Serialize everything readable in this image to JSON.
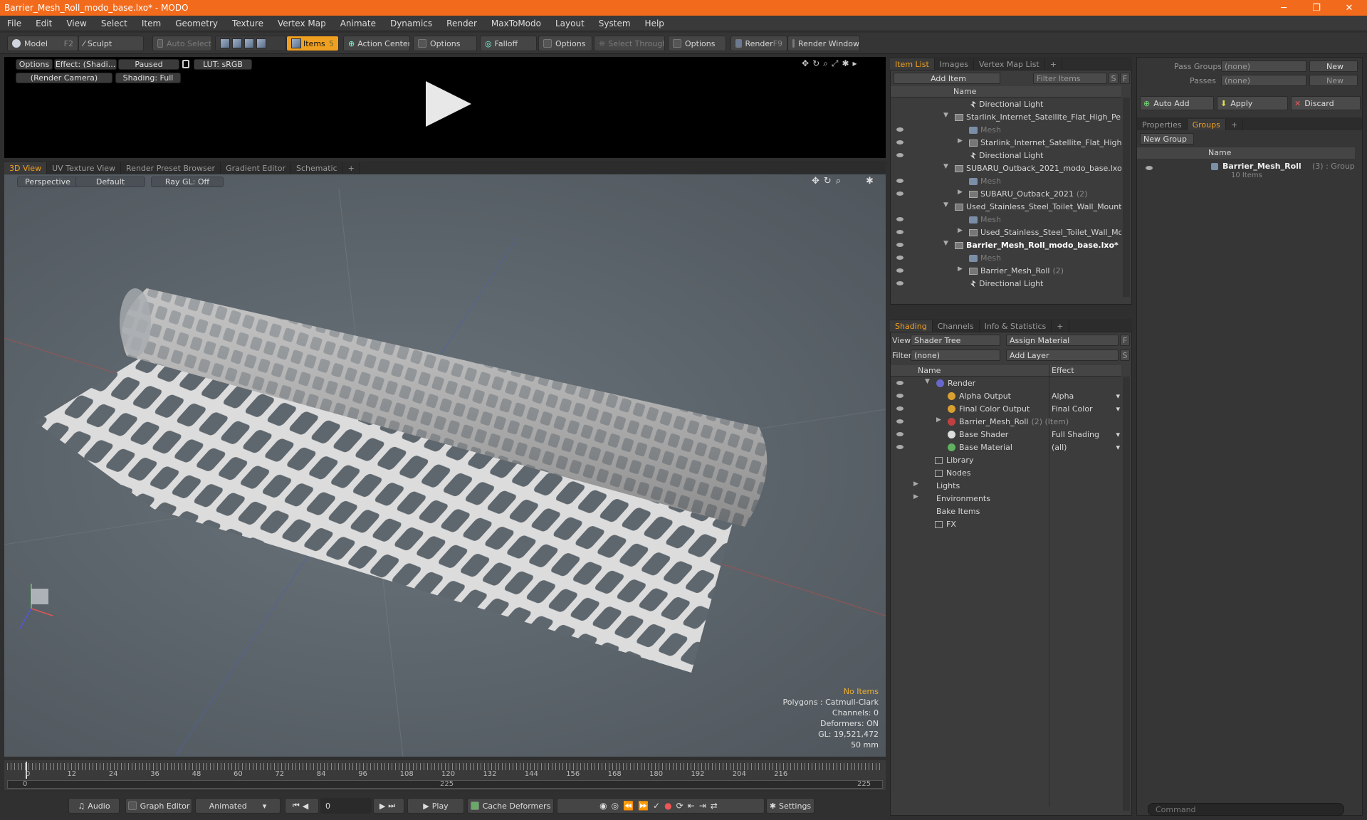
{
  "window": {
    "title": "Barrier_Mesh_Roll_modo_base.lxo* - MODO",
    "minimize": "─",
    "maximize": "❐",
    "close": "✕"
  },
  "menu": [
    "File",
    "Edit",
    "View",
    "Select",
    "Item",
    "Geometry",
    "Texture",
    "Vertex Map",
    "Animate",
    "Dynamics",
    "Render",
    "MaxToModo",
    "Layout",
    "System",
    "Help"
  ],
  "toolbar": {
    "model": "Model",
    "model_key": "F2",
    "sculpt": "Sculpt",
    "auto_select": "Auto Select",
    "items": "Items",
    "items_key": "5",
    "action_center": "Action Center",
    "options1": "Options",
    "falloff": "Falloff",
    "options2": "Options",
    "select_through": "Select Through",
    "options3": "Options",
    "render": "Render",
    "render_key": "F9",
    "render_window": "Render Window"
  },
  "render_view": {
    "options": "Options",
    "effect": "Effect: (Shadi...",
    "paused": "Paused",
    "lut": "LUT: sRGB",
    "camera": "(Render Camera)",
    "shading": "Shading: Full"
  },
  "view_tabs": [
    "3D View",
    "UV Texture View",
    "Render Preset Browser",
    "Gradient Editor",
    "Schematic",
    "+"
  ],
  "viewport": {
    "perspective": "Perspective",
    "default": "Default",
    "raygl": "Ray GL: Off"
  },
  "viewport_info": {
    "no_items": "No Items",
    "polygons": "Polygons : Catmull-Clark",
    "channels": "Channels: 0",
    "deformers": "Deformers: ON",
    "gl": "GL: 19,521,472",
    "scale": "50 mm"
  },
  "timeline": {
    "ticks": [
      "0",
      "12",
      "24",
      "36",
      "48",
      "60",
      "72",
      "84",
      "96",
      "108",
      "120",
      "132",
      "144",
      "156",
      "168",
      "180",
      "192",
      "204",
      "216"
    ],
    "start": "0",
    "mid": "225",
    "end": "225"
  },
  "bottombar": {
    "audio": "Audio",
    "graph_editor": "Graph Editor",
    "animated": "Animated",
    "frame": "0",
    "play": "Play",
    "cache_deformers": "Cache Deformers",
    "settings": "Settings"
  },
  "item_list": {
    "tabs": [
      "Item List",
      "Images",
      "Vertex Map List",
      "+"
    ],
    "add_item": "Add Item",
    "filter_items": "Filter Items",
    "s": "S",
    "f": "F",
    "col_name": "Name",
    "rows": [
      {
        "label": "Directional Light",
        "extra": ""
      },
      {
        "label": "Starlink_Internet_Satellite_Flat_High_Pe...",
        "extra": ""
      },
      {
        "label": "Mesh",
        "extra": ""
      },
      {
        "label": "Starlink_Internet_Satellite_Flat_High_...",
        "extra": ""
      },
      {
        "label": "Directional Light",
        "extra": ""
      },
      {
        "label": "SUBARU_Outback_2021_modo_base.lxo*",
        "extra": ""
      },
      {
        "label": "Mesh",
        "extra": ""
      },
      {
        "label": "SUBARU_Outback_2021",
        "extra": "(2)"
      },
      {
        "label": "Used_Stainless_Steel_Toilet_Wall_Mount...",
        "extra": ""
      },
      {
        "label": "Mesh",
        "extra": ""
      },
      {
        "label": "Used_Stainless_Steel_Toilet_Wall_Mo ...",
        "extra": ""
      },
      {
        "label": "Barrier_Mesh_Roll_modo_base.lxo*",
        "extra": ""
      },
      {
        "label": "Mesh",
        "extra": ""
      },
      {
        "label": "Barrier_Mesh_Roll",
        "extra": "(2)"
      },
      {
        "label": "Directional Light",
        "extra": ""
      }
    ]
  },
  "shading": {
    "tabs": [
      "Shading",
      "Channels",
      "Info & Statistics",
      "+"
    ],
    "view_label": "View",
    "view_value": "Shader Tree",
    "assign_material": "Assign Material",
    "f": "F",
    "filter_label": "Filter",
    "filter_value": "(none)",
    "add_layer": "Add Layer",
    "s": "S",
    "col_name": "Name",
    "col_effect": "Effect",
    "rows": [
      {
        "label": "Render",
        "effect": ""
      },
      {
        "label": "Alpha Output",
        "effect": "Alpha"
      },
      {
        "label": "Final Color Output",
        "effect": "Final Color"
      },
      {
        "label": "Barrier_Mesh_Roll",
        "extra": "(2) (Item)",
        "effect": ""
      },
      {
        "label": "Base Shader",
        "effect": "Full Shading"
      },
      {
        "label": "Base Material",
        "effect": "(all)"
      },
      {
        "label": "Library",
        "effect": ""
      },
      {
        "label": "Nodes",
        "effect": ""
      },
      {
        "label": "Lights",
        "effect": ""
      },
      {
        "label": "Environments",
        "effect": ""
      },
      {
        "label": "Bake Items",
        "effect": ""
      },
      {
        "label": "FX",
        "effect": ""
      }
    ]
  },
  "groups": {
    "pass_groups": "Pass Groups",
    "pass_groups_value": "(none)",
    "new": "New",
    "passes": "Passes",
    "passes_value": "(none)",
    "new2": "New",
    "auto_add": "Auto Add",
    "apply": "Apply",
    "discard": "Discard",
    "tabs": [
      "Properties",
      "Groups",
      "+"
    ],
    "new_group": "New Group",
    "col_name": "Name",
    "item_name": "Barrier_Mesh_Roll",
    "item_extra": "(3) : Group",
    "item_sub": "10 Items"
  },
  "command": {
    "placeholder": "Command"
  }
}
